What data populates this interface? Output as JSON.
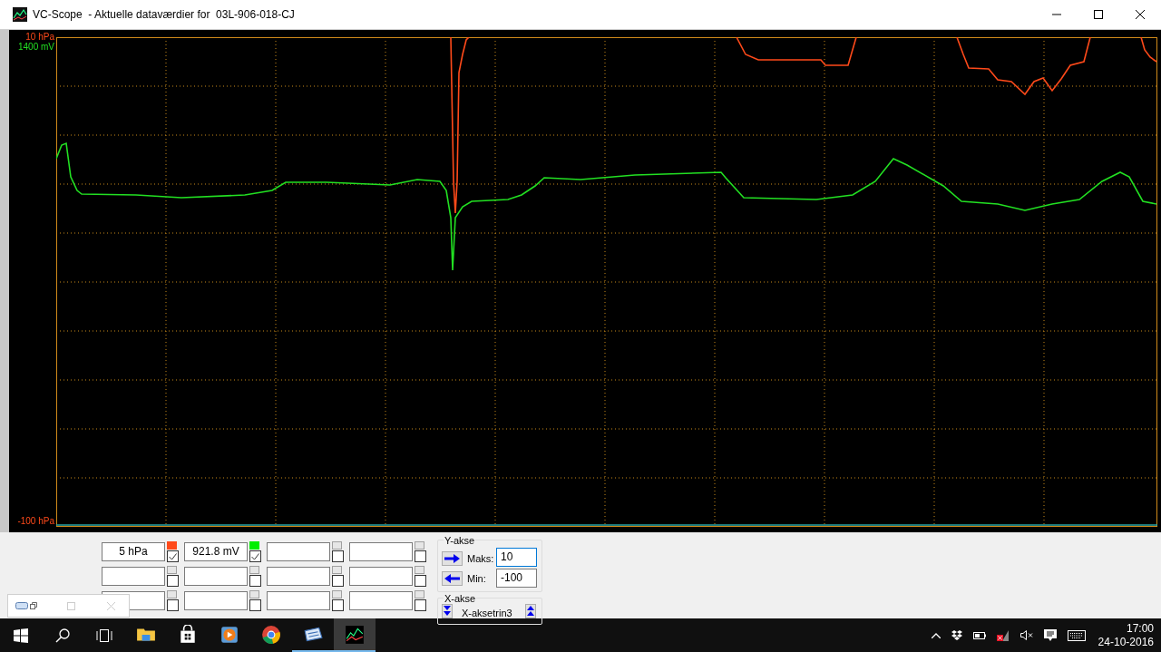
{
  "window": {
    "title": "VC-Scope  - Aktuelle dataværdier for  03L-906-018-CJ"
  },
  "plot": {
    "top_labels": [
      {
        "text": "10 hPa",
        "color": "#ff4a1a"
      },
      {
        "text": "1400 mV",
        "color": "#22e022"
      }
    ],
    "bottom_label": {
      "text": "-100 hPa",
      "color": "#ff4a1a"
    }
  },
  "channels": [
    {
      "value": "5 hPa",
      "color": "#ff4a1a",
      "checked": true
    },
    {
      "value": "921.8 mV",
      "color": "#00ee00",
      "checked": true
    },
    {
      "checked": false
    },
    {
      "checked": false
    },
    {
      "checked": false
    },
    {
      "checked": false
    },
    {
      "checked": false
    },
    {
      "checked": false
    },
    {
      "checked": false
    },
    {
      "checked": false
    },
    {
      "checked": false
    },
    {
      "checked": false
    }
  ],
  "y_axis": {
    "title": "Y-akse",
    "max_label": "Maks:",
    "max_value": "10",
    "min_label": "Min:",
    "min_value": "-100"
  },
  "x_axis": {
    "title": "X-akse",
    "value": "X-aksetrin3"
  },
  "taskbar": {
    "apps": [
      {
        "kind": "folder",
        "running": false,
        "selected": false
      },
      {
        "kind": "store",
        "running": false,
        "selected": false
      },
      {
        "kind": "media",
        "running": false,
        "selected": false
      },
      {
        "kind": "browser",
        "running": false,
        "selected": false
      },
      {
        "kind": "vcds",
        "running": true,
        "selected": false
      },
      {
        "kind": "scope",
        "running": true,
        "selected": true
      }
    ],
    "time": "17:00",
    "date": "24-10-2016"
  }
}
